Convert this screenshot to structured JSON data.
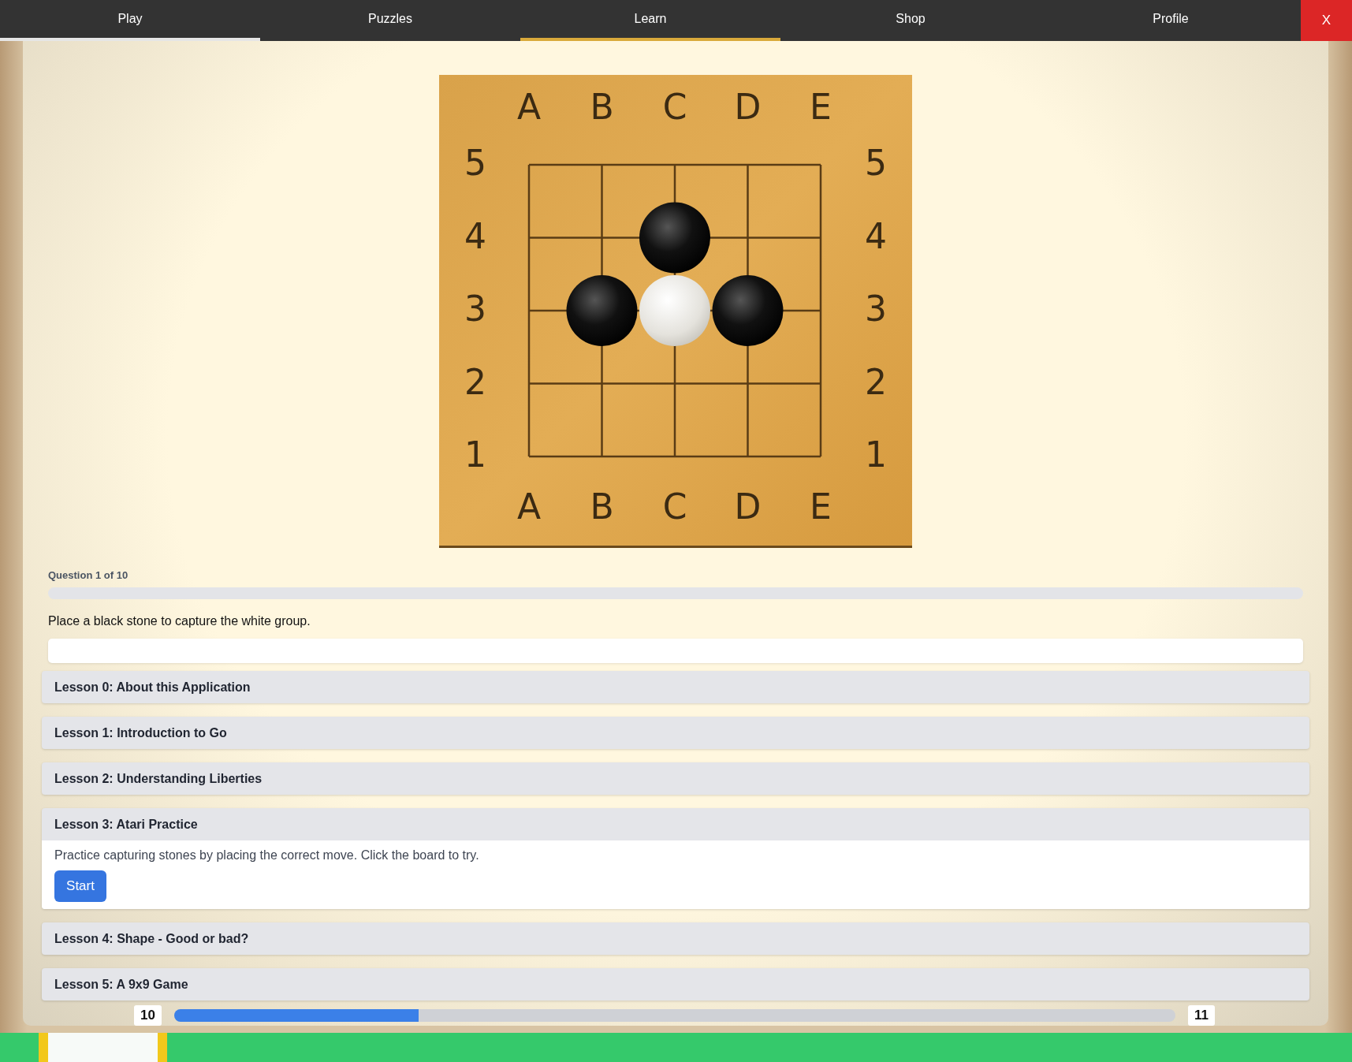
{
  "nav": {
    "tabs": [
      {
        "label": "Play",
        "selected": false,
        "focused": true
      },
      {
        "label": "Puzzles",
        "selected": false,
        "focused": false
      },
      {
        "label": "Learn",
        "selected": true,
        "focused": false
      },
      {
        "label": "Shop",
        "selected": false,
        "focused": false
      },
      {
        "label": "Profile",
        "selected": false,
        "focused": false
      }
    ],
    "close": "X"
  },
  "board": {
    "top_labels": [
      "A",
      "B",
      "C",
      "D",
      "E"
    ],
    "bottom_labels": [
      "A",
      "B",
      "C",
      "D",
      "E"
    ],
    "left_labels": [
      "5",
      "4",
      "3",
      "2",
      "1"
    ],
    "right_labels": [
      "5",
      "4",
      "3",
      "2",
      "1"
    ],
    "points": [
      [
        {
          "kind": "empty"
        },
        {
          "kind": "empty"
        },
        {
          "kind": "empty"
        },
        {
          "kind": "empty"
        },
        {
          "kind": "empty"
        }
      ],
      [
        {
          "kind": "empty"
        },
        {
          "kind": "empty"
        },
        {
          "kind": "black"
        },
        {
          "kind": "empty"
        },
        {
          "kind": "empty"
        }
      ],
      [
        {
          "kind": "empty"
        },
        {
          "kind": "black"
        },
        {
          "kind": "white"
        },
        {
          "kind": "black"
        },
        {
          "kind": "empty"
        }
      ],
      [
        {
          "kind": "empty"
        },
        {
          "kind": "empty"
        },
        {
          "kind": "empty"
        },
        {
          "kind": "empty"
        },
        {
          "kind": "empty"
        }
      ],
      [
        {
          "kind": "empty"
        },
        {
          "kind": "empty"
        },
        {
          "kind": "empty"
        },
        {
          "kind": "empty"
        },
        {
          "kind": "empty"
        }
      ]
    ]
  },
  "question": {
    "label": "Question 1 of 10",
    "prompt": "Place a black stone to capture the white group."
  },
  "lessons": [
    {
      "title": "Lesson 0: About this Application",
      "expanded": false
    },
    {
      "title": "Lesson 1: Introduction to Go",
      "expanded": false
    },
    {
      "title": "Lesson 2: Understanding Liberties",
      "expanded": false
    },
    {
      "title": "Lesson 3: Atari Practice",
      "expanded": true,
      "body": "Practice capturing stones by placing the correct move. Click the board to try.",
      "button": "Start"
    },
    {
      "title": "Lesson 4: Shape - Good or bad?",
      "expanded": false
    },
    {
      "title": "Lesson 5: A 9x9 Game",
      "expanded": false
    }
  ],
  "level_bar": {
    "current": "10",
    "next": "11",
    "level": 0.244
  }
}
